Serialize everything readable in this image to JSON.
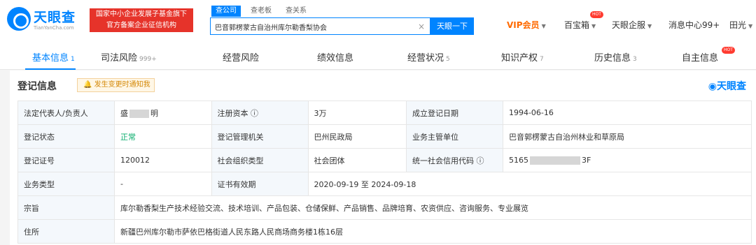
{
  "logo": {
    "name": "天眼查",
    "site": "TianYanCha.com"
  },
  "government_badge": {
    "line1": "国家中小企业发展子基金旗下",
    "line2": "官方备案企业征信机构"
  },
  "search": {
    "tabs": [
      "查公司",
      "查老板",
      "查关系"
    ],
    "query": "巴音郭楞蒙古自治州库尔勒香梨协会",
    "clear_icon": "close-icon",
    "button": "天眼一下"
  },
  "top_nav": [
    "VIP会员",
    "百宝箱",
    "天眼企服",
    "消息中心99+",
    "田光"
  ],
  "hot_badge": "HOT",
  "tabs": [
    {
      "label": "基本信息",
      "count": "1"
    },
    {
      "label": "司法风险",
      "count": "999+"
    },
    {
      "label": "经营风险",
      "count": ""
    },
    {
      "label": "绩效信息",
      "count": ""
    },
    {
      "label": "经营状况",
      "count": "5"
    },
    {
      "label": "知识产权",
      "count": "7"
    },
    {
      "label": "历史信息",
      "count": "3"
    },
    {
      "label": "自主信息",
      "count": ""
    }
  ],
  "section": {
    "title": "登记信息",
    "notice": "发生变更时通知我",
    "brand": "天眼查"
  },
  "registration": {
    "legal_representative_label": "法定代表人/负责人",
    "legal_representative_visible_start": "盛",
    "legal_representative_visible_end": "明",
    "registered_capital_label": "注册资本",
    "registered_capital_value": "3万",
    "established_date_label": "成立登记日期",
    "established_date_value": "1994-06-16",
    "status_label": "登记状态",
    "status_value": "正常",
    "authority_label": "登记管理机关",
    "authority_value": "巴州民政局",
    "supervisor_label": "业务主管单位",
    "supervisor_value": "巴音郭楞蒙古自治州林业和草原局",
    "certificate_label": "登记证号",
    "certificate_value": "120012",
    "organization_type_label": "社会组织类型",
    "organization_type_value": "社会团体",
    "credit_code_label": "统一社会信用代码",
    "credit_code_visible_start": "5165",
    "credit_code_visible_end": "3F",
    "business_type_label": "业务类型",
    "business_type_value": "-",
    "validity_label": "证书有效期",
    "validity_value": "2020-09-19 至 2024-09-18",
    "purpose_label": "宗旨",
    "purpose_value": "库尔勒香梨生产技术经验交流、技术培训、产品包装、仓储保鲜、产品销售、品牌培育、农资供应、咨询服务、专业展览",
    "address_label": "住所",
    "address_value": "新疆巴州库尔勒市萨依巴格街道人民东路人民商场商务楼1栋16层"
  },
  "colors": {
    "primary": "#0084ff",
    "hot": "#ff3b30",
    "vip": "#ff6a00",
    "status_normal": "#0bad6d"
  }
}
